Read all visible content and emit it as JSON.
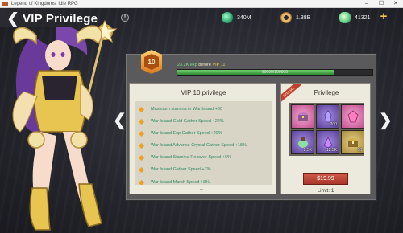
{
  "window": {
    "title": "Legend of Kingdoms: Idle RPG",
    "minimize": "–",
    "maximize": "☐",
    "close": "✕"
  },
  "header": {
    "back": "❮",
    "title": "VIP Privilege",
    "info": "!"
  },
  "currencies": [
    {
      "name": "green-orb",
      "value": "340M",
      "color": "#2aa46a"
    },
    {
      "name": "gold-ring",
      "value": "1.38B",
      "color": "#e6b86a"
    },
    {
      "name": "green-gem",
      "value": "41321",
      "color": "#6ad08a"
    }
  ],
  "plus": "+",
  "nav": {
    "left": "❮",
    "right": "❯"
  },
  "vip": {
    "level": "10",
    "exp_amount": "23.2K exp",
    "exp_before": " before ",
    "next_vip": "VIP 11",
    "progress_text": "80000/100000",
    "progress": 0.8
  },
  "privilege_list": {
    "title": "VIP 10 privilege",
    "items": [
      "Maximum stamina in War Island +60",
      "War Island Gold Gather Speed +22%",
      "War Island Exp Gather Speed +20%",
      "War Island Advance Crystal Gather Speed +18%",
      "War Island Stamina Recover Speed +6%",
      "War Island Gather Speed +7%",
      "War Island March Speed +8%"
    ],
    "scroll": "⌄"
  },
  "privilege_rewards": {
    "title": "Privilege",
    "ribbon": "SPECIAL",
    "items": [
      {
        "icon": "treasure-chest-icon",
        "qty": ""
      },
      {
        "icon": "purple-crystal-icon",
        "qty": "200"
      },
      {
        "icon": "pink-gem-icon",
        "qty": ""
      },
      {
        "icon": "potion-bag-icon",
        "qty": "2.5K"
      },
      {
        "icon": "purple-shard-icon",
        "qty": "12.5K"
      },
      {
        "icon": "gold-chest-icon",
        "qty": "30"
      }
    ],
    "price": "$19.99",
    "limit": "Limit: 1"
  }
}
